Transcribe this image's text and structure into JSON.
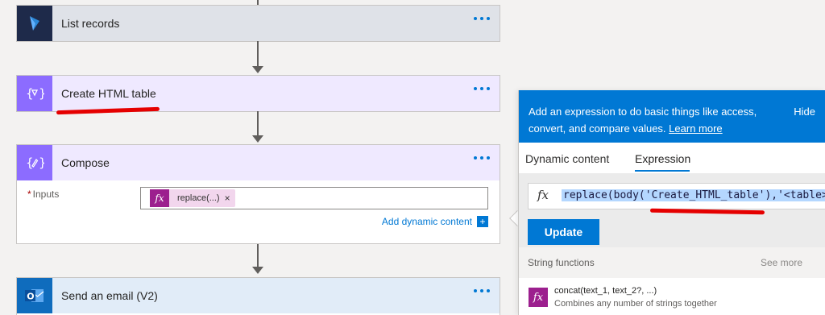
{
  "flow": {
    "cards": [
      {
        "title": "List records",
        "color": "#1e2a4a"
      },
      {
        "title": "Create HTML table",
        "color": "#8c6cff"
      },
      {
        "title": "Compose",
        "color": "#8c6cff"
      },
      {
        "title": "Send an email (V2)",
        "color": "#0f6cbd"
      }
    ],
    "compose": {
      "inputs_label": "Inputs",
      "required_mark": "*",
      "token_fx": "fx",
      "token_text": "replace(...)",
      "token_remove": "×",
      "add_dynamic": "Add dynamic content",
      "add_plus": "+"
    }
  },
  "panel": {
    "info_line1": "Add an expression to do basic things like access,",
    "info_line2": "convert, and compare values.",
    "learn_more": "Learn more",
    "hide": "Hide",
    "tabs": [
      "Dynamic content",
      "Expression"
    ],
    "active_tab": "Expression",
    "expr_fx": "fx",
    "expression": "replace(body('Create_HTML_table'),'<table>",
    "update": "Update",
    "section_title": "String functions",
    "see_more": "See more",
    "function": {
      "icon": "fx",
      "name": "concat(text_1, text_2?, ...)",
      "description": "Combines any number of strings together"
    }
  },
  "colors": {
    "accent": "#0078d4",
    "annotation": "#e50000",
    "fx_token": "#9c1f8e"
  }
}
